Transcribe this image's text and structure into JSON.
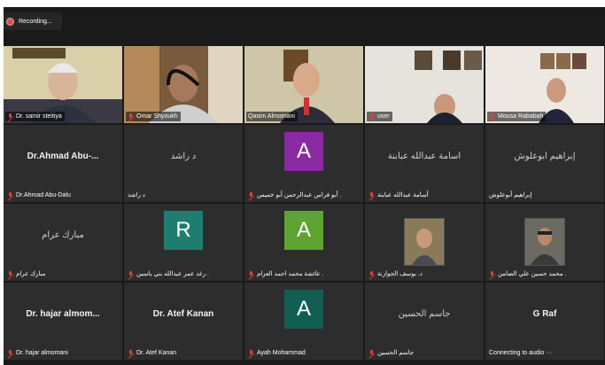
{
  "recording": {
    "label": "Recording..."
  },
  "colors": {
    "accent": "#9ccc3b",
    "mic_muted": "#e0403a",
    "avatar_purple": "#8a2aa3",
    "avatar_teal": "#1f7d70",
    "avatar_green": "#5fa332",
    "avatar_darkteal": "#135e52"
  },
  "participants": [
    {
      "label": "Dr. samir steitiya",
      "muted": true,
      "type": "video"
    },
    {
      "label": "Omar Shyoukh",
      "muted": true,
      "type": "video"
    },
    {
      "label": "Qasim Almomani",
      "muted": false,
      "type": "video",
      "active": true
    },
    {
      "label": "user",
      "muted": true,
      "type": "video"
    },
    {
      "label": "Mousa Rababah",
      "muted": true,
      "type": "video"
    },
    {
      "display_name": "Dr.Ahmad Abu-...",
      "label": "Dr.Ahmad Abu-Dalu",
      "muted": true,
      "type": "name"
    },
    {
      "display_name": "د راشد",
      "label": "د راشد",
      "muted": false,
      "type": "name-light"
    },
    {
      "avatar": "A",
      "label": "أبو فراس عبدالرحمن أبو خميس .",
      "muted": true,
      "type": "avatar",
      "color": "#8a2aa3"
    },
    {
      "display_name": "أسامة عبدالله عبابنة",
      "label": "أسامة عبدالله عبابنة",
      "muted": true,
      "type": "name-light"
    },
    {
      "display_name": "إبراهيم أبوعلوش",
      "label": "إبراهيم أبوعلوش",
      "muted": false,
      "type": "name-light"
    },
    {
      "display_name": "مبارك عرام",
      "label": "مبارك عرام",
      "muted": true,
      "type": "name-light"
    },
    {
      "avatar": "R",
      "label": "رغد عمر عبدالله بني ياسين .",
      "muted": true,
      "type": "avatar",
      "color": "#1f7d70"
    },
    {
      "avatar": "A",
      "label": "عائشة محمد احمد العزام .",
      "muted": true,
      "type": "avatar",
      "color": "#5fa332"
    },
    {
      "label": "د. يوسف الجوازنة",
      "muted": true,
      "type": "thumb"
    },
    {
      "label": "محمد حسين علي الضامن .",
      "muted": true,
      "type": "thumb"
    },
    {
      "display_name": "Dr. hajar almom...",
      "label": "Dr. hajar almomani",
      "muted": true,
      "type": "name"
    },
    {
      "display_name": "Dr. Atef Kanan",
      "label": "Dr. Atef Kanan",
      "muted": true,
      "type": "name"
    },
    {
      "avatar": "A",
      "label": "Ayah Mohammad",
      "muted": true,
      "type": "avatar",
      "color": "#135e52"
    },
    {
      "display_name": "جاسم الحسين",
      "label": "جاسم الحسين",
      "muted": true,
      "type": "name-light"
    },
    {
      "display_name": "G Raf",
      "label": "Connecting to audio ···",
      "muted": false,
      "type": "name"
    }
  ]
}
